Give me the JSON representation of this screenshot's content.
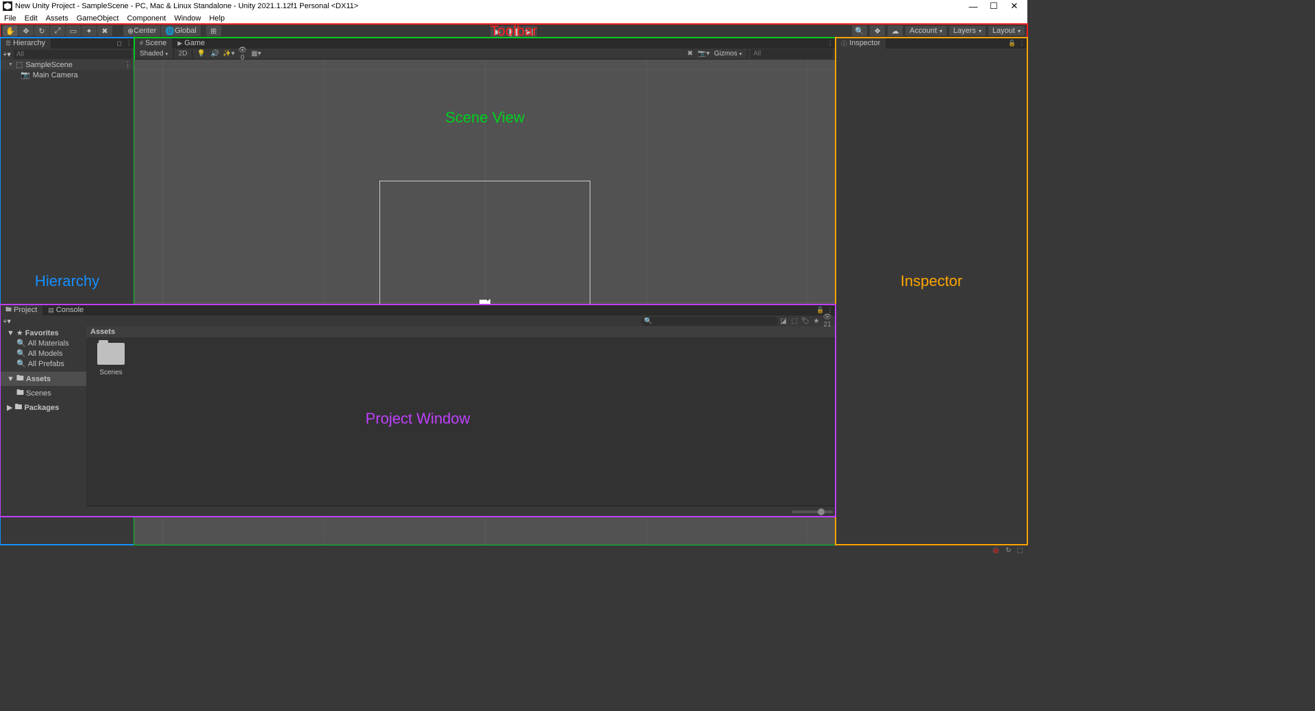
{
  "title": "New Unity Project - SampleScene - PC, Mac & Linux Standalone - Unity 2021.1.12f1 Personal <DX11>",
  "menu": [
    "File",
    "Edit",
    "Assets",
    "GameObject",
    "Component",
    "Window",
    "Help"
  ],
  "toolbar": {
    "pivot": "Center",
    "space": "Global",
    "account": "Account",
    "layers": "Layers",
    "layout": "Layout",
    "annotation": "Toolbar"
  },
  "hierarchy": {
    "tab": "Hierarchy",
    "search_placeholder": "All",
    "scene": "SampleScene",
    "items": [
      "Main Camera"
    ],
    "annotation": "Hierarchy"
  },
  "scene": {
    "tabs": [
      "Scene",
      "Game"
    ],
    "shading": "Shaded",
    "mode2d": "2D",
    "gizmos": "Gizmos",
    "search_placeholder": "All",
    "annotation": "Scene View"
  },
  "project": {
    "tabs": [
      "Project",
      "Console"
    ],
    "favorites": "Favorites",
    "fav_items": [
      "All Materials",
      "All Models",
      "All Prefabs"
    ],
    "assets": "Assets",
    "assets_items": [
      "Scenes"
    ],
    "packages": "Packages",
    "breadcrumb": "Assets",
    "folder": "Scenes",
    "hidden_count": "21",
    "annotation": "Project Window"
  },
  "inspector": {
    "tab": "Inspector",
    "annotation": "Inspector"
  }
}
